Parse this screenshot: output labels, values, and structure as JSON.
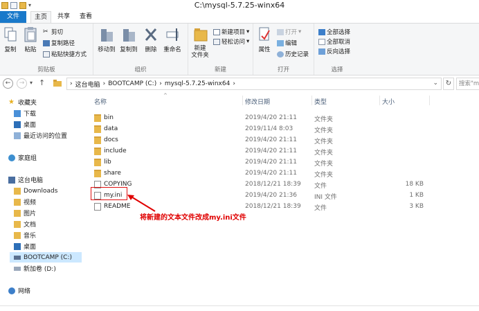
{
  "window": {
    "title": "C:\\mysql-5.7.25-winx64"
  },
  "tabs": {
    "file": "文件",
    "home": "主页",
    "share": "共享",
    "view": "查看"
  },
  "ribbon": {
    "clipboard": {
      "label": "剪贴板",
      "copy": "复制",
      "paste": "粘贴",
      "cut": "剪切",
      "copy_path": "复制路径",
      "paste_shortcut": "粘贴快捷方式"
    },
    "organize": {
      "label": "组织",
      "move_to": "移动到",
      "copy_to": "复制到",
      "delete": "删除",
      "rename": "重命名"
    },
    "new": {
      "label": "新建",
      "new_folder": "新建\n文件夹",
      "new_item": "新建项目",
      "easy_access": "轻松访问"
    },
    "open": {
      "label": "打开",
      "properties": "属性",
      "open": "打开",
      "edit": "编辑",
      "history": "历史记录"
    },
    "select": {
      "label": "选择",
      "select_all": "全部选择",
      "select_none": "全部取消",
      "invert": "反向选择"
    }
  },
  "address": {
    "crumbs": [
      "这台电脑",
      "BOOTCAMP (C:)",
      "mysql-5.7.25-winx64"
    ],
    "search_placeholder": "搜索\"m"
  },
  "nav": {
    "favorites": "收藏夹",
    "fav_items": [
      "下载",
      "桌面",
      "最近访问的位置"
    ],
    "homegroup": "家庭组",
    "thispc": "这台电脑",
    "pc_items": [
      "Downloads",
      "视频",
      "图片",
      "文档",
      "音乐",
      "桌面",
      "BOOTCAMP (C:)",
      "新加卷 (D:)"
    ],
    "network": "网络"
  },
  "columns": {
    "name": "名称",
    "date": "修改日期",
    "type": "类型",
    "size": "大小"
  },
  "files": [
    {
      "name": "bin",
      "date": "2019/4/20 21:11",
      "type": "文件夹",
      "size": ""
    },
    {
      "name": "data",
      "date": "2019/11/4 8:03",
      "type": "文件夹",
      "size": ""
    },
    {
      "name": "docs",
      "date": "2019/4/20 21:11",
      "type": "文件夹",
      "size": ""
    },
    {
      "name": "include",
      "date": "2019/4/20 21:11",
      "type": "文件夹",
      "size": ""
    },
    {
      "name": "lib",
      "date": "2019/4/20 21:11",
      "type": "文件夹",
      "size": ""
    },
    {
      "name": "share",
      "date": "2019/4/20 21:11",
      "type": "文件夹",
      "size": ""
    },
    {
      "name": "COPYING",
      "date": "2018/12/21 18:39",
      "type": "文件",
      "size": "18 KB"
    },
    {
      "name": "my.ini",
      "date": "2019/4/20 21:36",
      "type": "INI 文件",
      "size": "1 KB"
    },
    {
      "name": "README",
      "date": "2018/12/21 18:39",
      "type": "文件",
      "size": "3 KB"
    }
  ],
  "annotation": "将新建的文本文件改成my.ini文件",
  "colors": {
    "accent": "#1979ca",
    "annotation": "#e00000",
    "selection": "#cce8ff"
  }
}
